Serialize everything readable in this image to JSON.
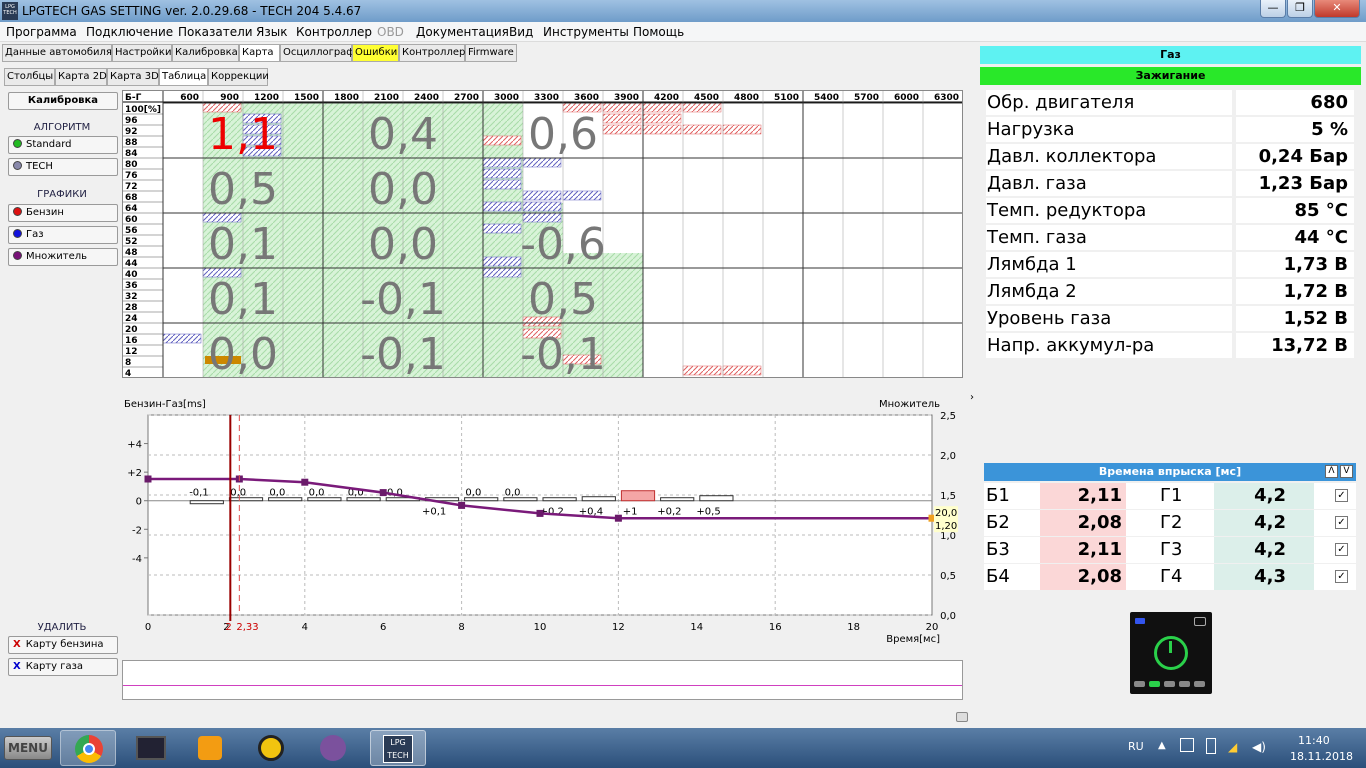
{
  "window": {
    "title": "LPGTECH GAS SETTING ver. 2.0.29.68  -  TECH 204   5.4.67",
    "logo_text": "LPG TECH",
    "min": "—",
    "max": "❐",
    "close": "✕"
  },
  "menu": [
    "Программа",
    "Подключение",
    "Показатели",
    "Язык",
    "Контроллер",
    "OBD",
    "Документация",
    "Вид",
    "Инструменты",
    "Помощь"
  ],
  "tabs1": [
    "Данные автомобиля",
    "Настройки",
    "Калибровка",
    "Карта",
    "Осциллограф",
    "Ошибки",
    "Контроллер",
    "Firmware"
  ],
  "tabs2": [
    "Столбцы",
    "Карта 2D",
    "Карта 3D",
    "Таблица",
    "Коррекции"
  ],
  "left": {
    "calib": "Калибровка",
    "algo_head": "АЛГОРИТМ",
    "algo": [
      {
        "label": "Standard",
        "color": "#22bb22"
      },
      {
        "label": "TECH",
        "color": "#8888aa"
      }
    ],
    "graph_head": "ГРАФИКИ",
    "graphs": [
      {
        "label": "Бензин",
        "color": "#dd1111"
      },
      {
        "label": "Газ",
        "color": "#1111dd"
      },
      {
        "label": "Множитель",
        "color": "#771177"
      }
    ],
    "del_head": "УДАЛИТЬ",
    "del": [
      {
        "x": "X",
        "label": "Карту бензина",
        "color": "#cc0000"
      },
      {
        "x": "X",
        "label": "Карту газа",
        "color": "#0000cc"
      }
    ]
  },
  "map": {
    "corner": "Б-Г",
    "cols": [
      "600",
      "900",
      "1200",
      "1500",
      "1800",
      "2100",
      "2400",
      "2700",
      "3000",
      "3300",
      "3600",
      "3900",
      "4200",
      "4500",
      "4800",
      "5100",
      "5400",
      "5700",
      "6000",
      "6300"
    ],
    "rows": [
      "100[%]",
      "96",
      "92",
      "88",
      "84",
      "80",
      "76",
      "72",
      "68",
      "64",
      "60",
      "56",
      "52",
      "48",
      "44",
      "40",
      "36",
      "32",
      "28",
      "24",
      "20",
      "16",
      "12",
      "8",
      "4"
    ],
    "big": [
      [
        "1,1",
        "0,4",
        "0,6"
      ],
      [
        "0,5",
        "0,0",
        ""
      ],
      [
        "0,1",
        "0,0",
        "-0,6"
      ],
      [
        "0,1",
        "-0,1",
        "0,5"
      ],
      [
        "0,0",
        "-0,1",
        "-0,1"
      ]
    ]
  },
  "chart": {
    "ylabel_left": "Бензин-Газ[ms]",
    "ylabel_right": "Множитель",
    "xlabel": "Время[мс]",
    "left_ticks": [
      "+4",
      "+2",
      "0",
      "-2",
      "-4"
    ],
    "right_ticks": [
      "2,5",
      "2,0",
      "1,5",
      "1,0",
      "0,5",
      "0,0"
    ],
    "x_ticks": [
      "0",
      "2",
      "4",
      "6",
      "8",
      "10",
      "12",
      "14",
      "16",
      "18",
      "20"
    ],
    "cursor": "2,33",
    "cursor_mark": "2",
    "right_value": "20,0",
    "right_value2": "1,20",
    "multiplier": [
      [
        0,
        1.7
      ],
      [
        2.33,
        1.7
      ],
      [
        4,
        1.66
      ],
      [
        6,
        1.53
      ],
      [
        8,
        1.37
      ],
      [
        10,
        1.27
      ],
      [
        12,
        1.21
      ],
      [
        20,
        1.21
      ]
    ],
    "diffs_top": [
      {
        "x": 1.3,
        "v": "-0,1"
      },
      {
        "x": 2.3,
        "v": "0,0"
      },
      {
        "x": 3.3,
        "v": "0,0"
      },
      {
        "x": 4.3,
        "v": "0,0"
      },
      {
        "x": 5.3,
        "v": "0,0"
      },
      {
        "x": 6.3,
        "v": "0,0"
      },
      {
        "x": 8.3,
        "v": "0,0"
      },
      {
        "x": 9.3,
        "v": "0,0"
      }
    ],
    "diffs_bottom": [
      {
        "x": 7.3,
        "v": "+0,1"
      },
      {
        "x": 10.3,
        "v": "+0,2"
      },
      {
        "x": 11.3,
        "v": "+0,4"
      },
      {
        "x": 12.3,
        "v": "+1"
      },
      {
        "x": 13.3,
        "v": "+0,2"
      },
      {
        "x": 14.3,
        "v": "+0,5"
      }
    ],
    "bars": [
      {
        "x": 1,
        "w": 1,
        "v": -0.1
      },
      {
        "x": 2,
        "w": 1,
        "v": 0
      },
      {
        "x": 3,
        "w": 1,
        "v": 0
      },
      {
        "x": 4,
        "w": 1,
        "v": 0
      },
      {
        "x": 5,
        "w": 1,
        "v": 0
      },
      {
        "x": 6,
        "w": 1,
        "v": 0
      },
      {
        "x": 7,
        "w": 1,
        "v": 0.1
      },
      {
        "x": 8,
        "w": 1,
        "v": 0
      },
      {
        "x": 9,
        "w": 1,
        "v": 0
      },
      {
        "x": 10,
        "w": 1,
        "v": 0.2
      },
      {
        "x": 11,
        "w": 1,
        "v": 0.4
      },
      {
        "x": 12,
        "w": 1,
        "v": 1
      },
      {
        "x": 13,
        "w": 1,
        "v": 0.2
      },
      {
        "x": 14,
        "w": 1,
        "v": 0.5
      }
    ],
    "xlim": [
      0,
      20
    ],
    "ylim_left": [
      -8,
      6
    ],
    "ylim_right": [
      0,
      2.5
    ]
  },
  "right": {
    "gas_header": "Газ",
    "ign_header": "Зажигание",
    "params": [
      {
        "label": "Обр. двигателя",
        "value": "680"
      },
      {
        "label": "Нагрузка",
        "value": "5 %"
      },
      {
        "label": "Давл. коллектора",
        "value": "0,24 Бар"
      },
      {
        "label": "Давл. газа",
        "value": "1,23 Бар"
      },
      {
        "label": "Темп. редуктора",
        "value": "85 °C"
      },
      {
        "label": "Темп. газа",
        "value": "44 °C"
      },
      {
        "label": "Лямбда 1",
        "value": "1,73 В"
      },
      {
        "label": "Лямбда 2",
        "value": "1,72 В"
      },
      {
        "label": "Уровень газа",
        "value": "1,52 В"
      },
      {
        "label": "Напр. аккумул-ра",
        "value": "13,72 В"
      }
    ],
    "inj_header": "Времена впрыска [мс]",
    "inj": [
      {
        "b": "Б1",
        "bv": "2,11",
        "g": "Г1",
        "gv": "4,2"
      },
      {
        "b": "Б2",
        "bv": "2,08",
        "g": "Г2",
        "gv": "4,2"
      },
      {
        "b": "Б3",
        "bv": "2,11",
        "g": "Г3",
        "gv": "4,2"
      },
      {
        "b": "Б4",
        "bv": "2,08",
        "g": "Г4",
        "gv": "4,3"
      }
    ],
    "checkmark": "✓",
    "collapse_up": "Λ",
    "collapse_down": "V"
  },
  "taskbar": {
    "menu": "MENU",
    "lang": "RU",
    "time": "11:40",
    "date": "18.11.2018"
  }
}
